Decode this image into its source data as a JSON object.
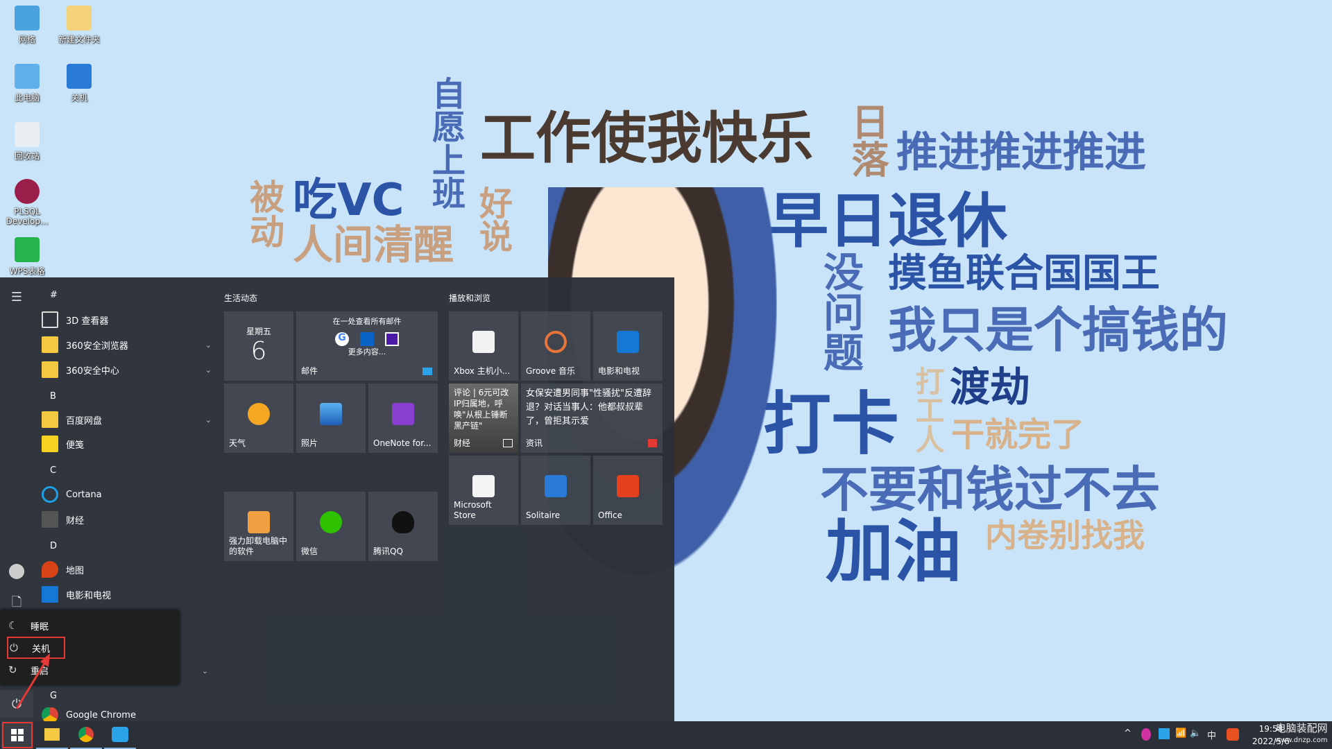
{
  "wallpaper": {
    "phrases": [
      "工作使我快乐",
      "推进推进推进",
      "早日退休",
      "摸鱼联合国国王",
      "我只是个搞钱的",
      "渡劫",
      "打卡",
      "干就完了",
      "不要和钱过不去",
      "加油",
      "内卷别找我",
      "吃VC",
      "人间清醒"
    ],
    "vertical": [
      "自愿上班",
      "好说",
      "被动",
      "日落",
      "没问题",
      "打工人"
    ]
  },
  "desktop": {
    "icons": [
      {
        "label": "网络"
      },
      {
        "label": "新建文件夹"
      },
      {
        "label": "此电脑"
      },
      {
        "label": "关机"
      },
      {
        "label": "回收站"
      },
      {
        "label": "PLSQL Develop..."
      },
      {
        "label": "WPS表格"
      }
    ]
  },
  "start": {
    "letters": [
      "#",
      "B",
      "C",
      "D",
      "G"
    ],
    "apps": [
      {
        "label": "3D 查看器"
      },
      {
        "label": "360安全浏览器"
      },
      {
        "label": "360安全中心"
      },
      {
        "label": "百度网盘"
      },
      {
        "label": "便笺"
      },
      {
        "label": "Cortana"
      },
      {
        "label": "财经"
      },
      {
        "label": "地图"
      },
      {
        "label": "电影和电视"
      },
      {
        "label": "Google Chrome"
      }
    ],
    "groups": [
      "生活动态",
      "播放和浏览"
    ],
    "tiles": {
      "calendar": {
        "day": "星期五",
        "date": "6"
      },
      "mail": {
        "header": "在一处查看所有邮件",
        "more": "更多内容...",
        "label": "邮件"
      },
      "weather": "天气",
      "photos": "照片",
      "onenote": "OneNote for...",
      "uninstall": "强力卸载电脑中的软件",
      "wechat": "微信",
      "qq": "腾讯QQ",
      "xbox": "Xbox 主机小...",
      "groove": "Groove 音乐",
      "movies": "电影和电视",
      "finance": {
        "headline": "评论 | 6元可改IP归属地，呼唤\"从根上锤断黑产链\"",
        "label": "财经"
      },
      "news": {
        "headline": "女保安遭男同事\"性骚扰\"反遭辞退？对话当事人：他都叔叔辈了，曾拒其示爱",
        "label": "资讯"
      },
      "store": "Microsoft Store",
      "solitaire": "Solitaire",
      "office": "Office"
    },
    "power_menu": {
      "sleep": "睡眠",
      "shutdown": "关机",
      "restart": "重启"
    }
  },
  "taskbar": {
    "ime": "中",
    "time": "19:58",
    "date": "2022/5/6",
    "watermark": "电脑装配网",
    "watermark_url": "www.dnzp.com"
  },
  "colors": {
    "highlight": "#e53935",
    "start_bg": "#2b3038",
    "wallpaper_bg": "#c9e4f8"
  }
}
